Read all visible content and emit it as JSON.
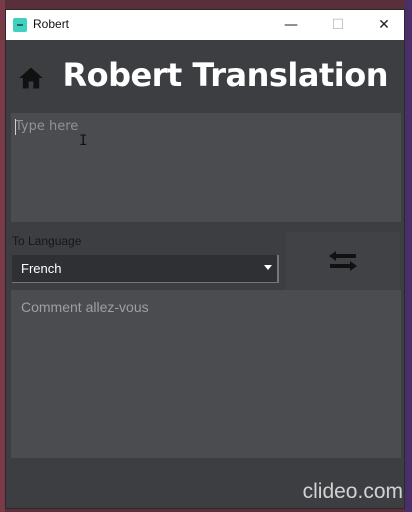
{
  "window": {
    "title": "Robert",
    "controls": {
      "minimize": "—",
      "maximize": "☐",
      "close": "✕"
    }
  },
  "header": {
    "home_icon": "home-icon",
    "title": "Robert Translation"
  },
  "input": {
    "placeholder": "Type here",
    "value": ""
  },
  "language": {
    "label": "To Language",
    "selected": "French"
  },
  "swap": {
    "icon": "swap-arrows-icon"
  },
  "output": {
    "text": "Comment allez-vous"
  },
  "watermark": "clideo.com"
}
